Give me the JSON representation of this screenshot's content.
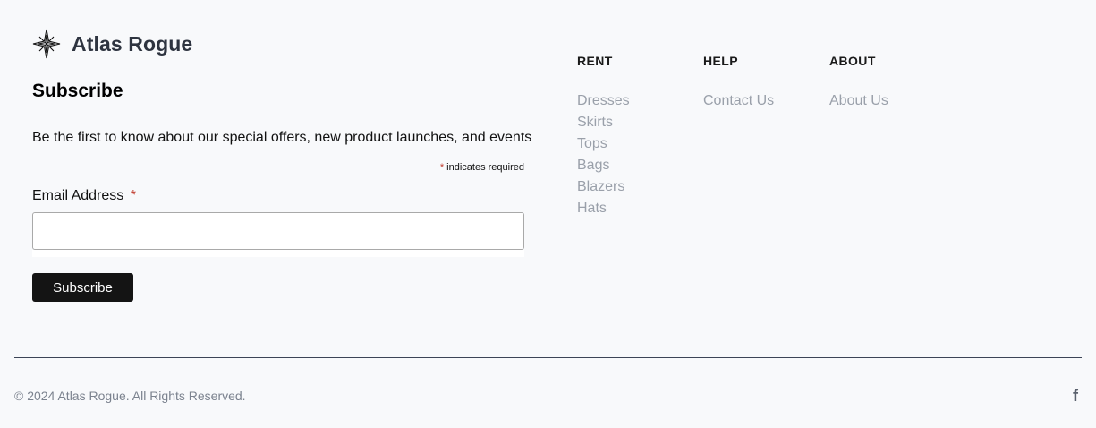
{
  "brand": {
    "name": "Atlas Rogue",
    "logo_icon": "compass-star-icon"
  },
  "subscribe": {
    "title": "Subscribe",
    "description": "Be the first to know about our special offers, new product launches, and events",
    "required_marker": "*",
    "required_note": "indicates required",
    "email_label": "Email Address",
    "email_value": "",
    "email_placeholder": "",
    "button_label": "Subscribe"
  },
  "nav": {
    "rent": {
      "heading": "RENT",
      "items": [
        "Dresses",
        "Skirts",
        "Tops",
        "Bags",
        "Blazers",
        "Hats"
      ]
    },
    "help": {
      "heading": "HELP",
      "items": [
        "Contact Us"
      ]
    },
    "about": {
      "heading": "ABOUT",
      "items": [
        "About Us"
      ]
    }
  },
  "footer": {
    "copyright": "© 2024 Atlas Rogue. All Rights Reserved.",
    "social": {
      "facebook_glyph": "f",
      "facebook_icon": "facebook-icon"
    }
  },
  "colors": {
    "background": "#f8f9fb",
    "accent_dark": "#141414",
    "link_muted": "#9aa0aa",
    "required": "#c0392b",
    "divider": "#3c4456"
  }
}
